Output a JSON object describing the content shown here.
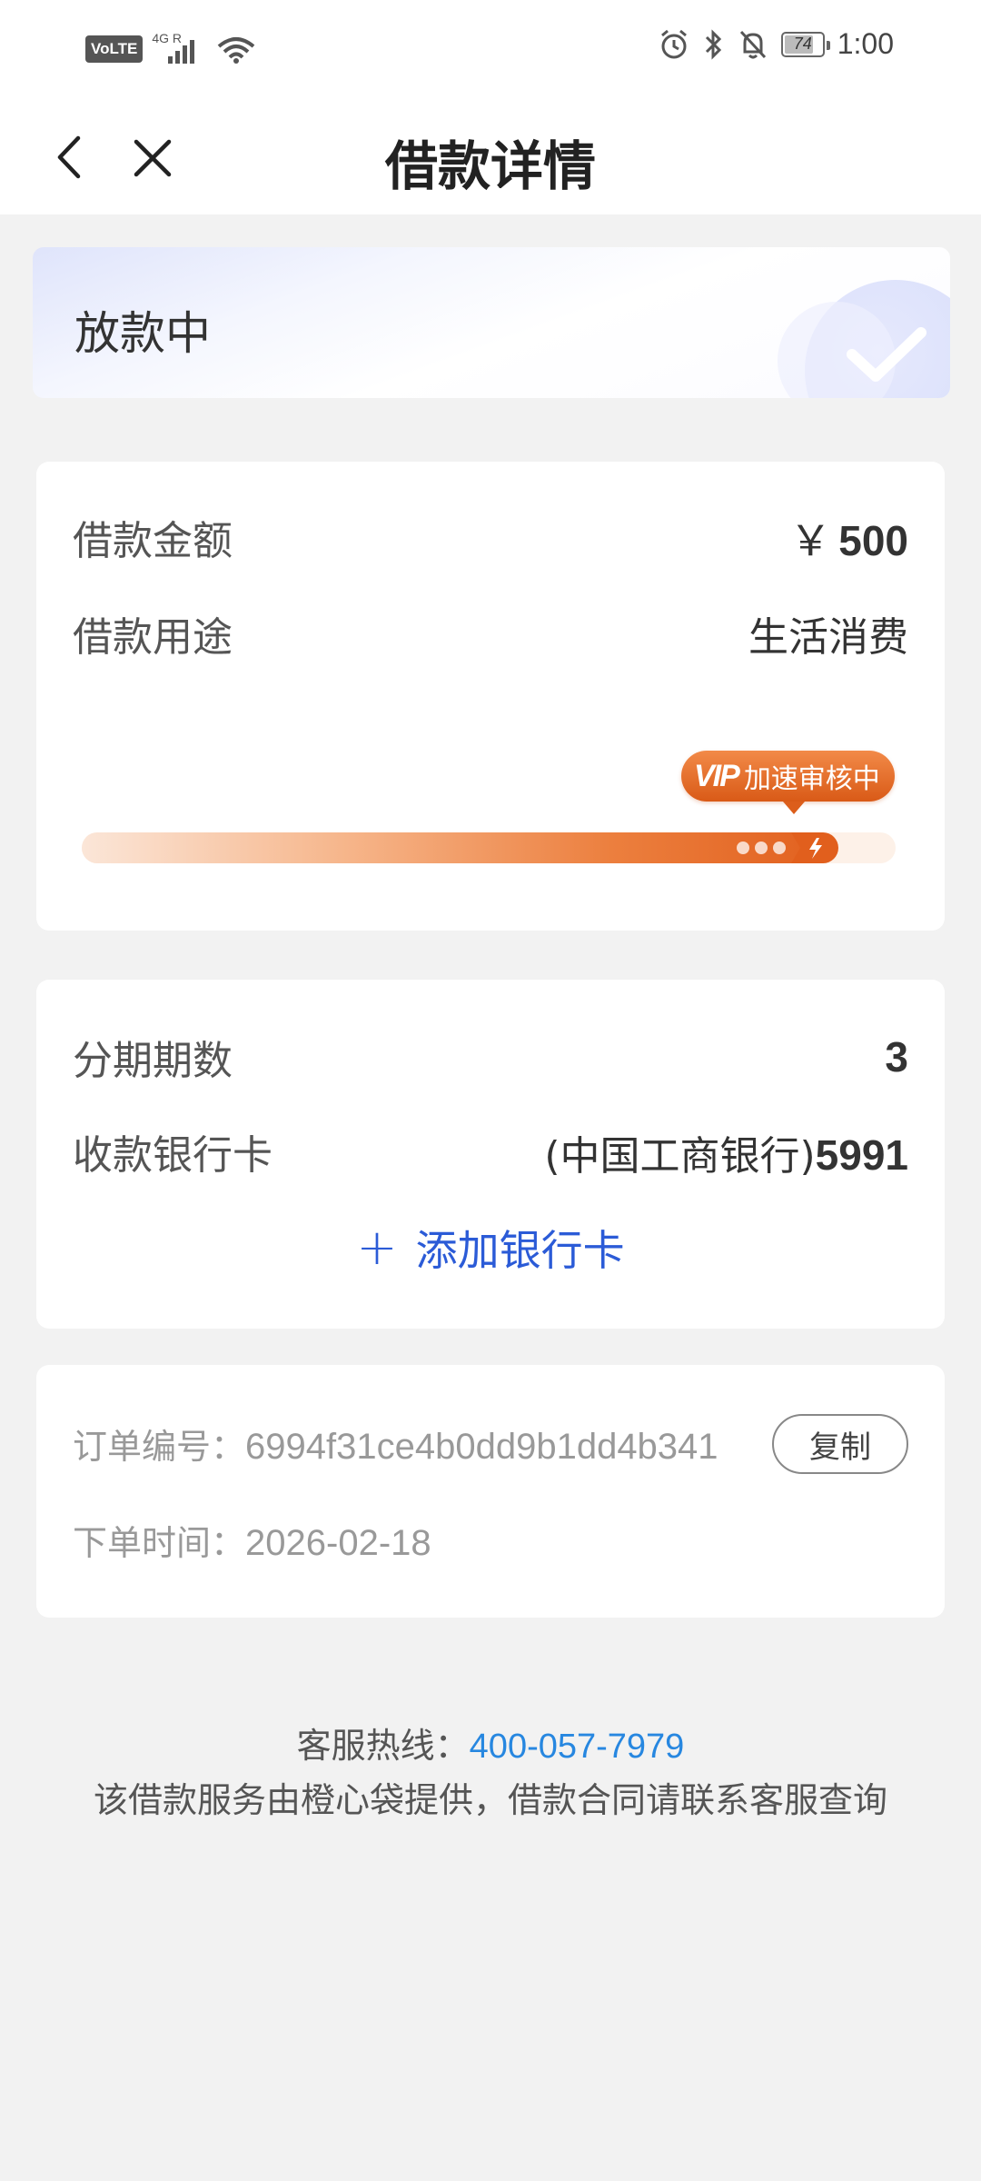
{
  "status_bar": {
    "volte_label": "VoLTE",
    "network_label": "4G R",
    "battery_level": "74",
    "time": "1:00"
  },
  "nav": {
    "title": "借款详情"
  },
  "loan_status": {
    "text": "放款中"
  },
  "loan_card": {
    "amount_label": "借款金额",
    "amount_currency": "￥",
    "amount_value": "500",
    "purpose_label": "借款用途",
    "purpose_value": "生活消费",
    "vip_label": "VIP",
    "vip_text": "加速审核中",
    "progress_fraction": 0.93,
    "accent_color": "#e1631f"
  },
  "installment_card": {
    "periods_label": "分期期数",
    "periods_value": "3",
    "bank_label": "收款银行卡",
    "bank_name": "(中国工商银行)",
    "bank_tail": "5991",
    "add_bank_label": "添加银行卡",
    "link_color": "#2b5bd7"
  },
  "order_card": {
    "order_no_label": "订单编号：",
    "order_no_value": "6994f31ce4b0dd9b1dd4b341",
    "copy_label": "复制",
    "order_time_label": "下单时间：",
    "order_time_value": "2026-02-18"
  },
  "footer": {
    "hotline_label": "客服热线：",
    "hotline_number": "400-057-7979",
    "notice": "该借款服务由橙心袋提供，借款合同请联系客服查询"
  }
}
